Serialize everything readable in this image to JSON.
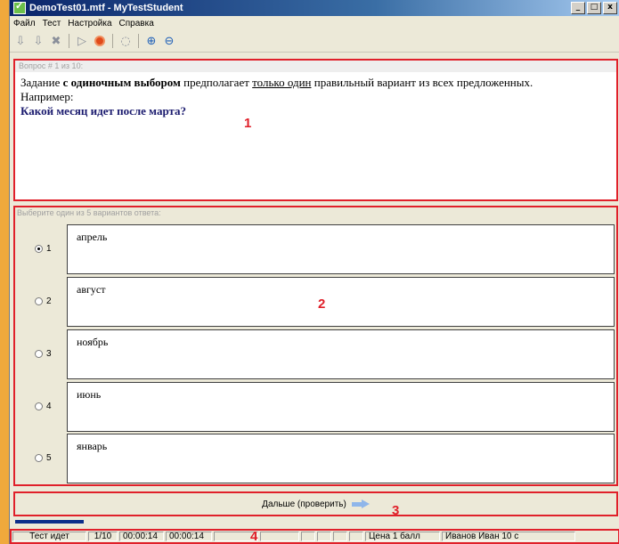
{
  "window": {
    "title": "DemoTest01.mtf - MyTestStudent"
  },
  "window_controls": {
    "minimize": "_",
    "maximize": "□",
    "close": "x"
  },
  "menu": [
    "Файл",
    "Тест",
    "Настройка",
    "Справка"
  ],
  "toolbar_icons": [
    "next-icon",
    "prev-icon",
    "delete-icon",
    "play-icon",
    "stop-icon",
    "help-icon",
    "zoom-in-icon",
    "zoom-out-icon"
  ],
  "question": {
    "header": "Вопрос # 1 из 10:",
    "text_part1": "Задание ",
    "text_bold": "с одиночным выбором",
    "text_part2": " предполагает ",
    "text_underline": "только один",
    "text_part3": " правильный вариант из всех предложенных.",
    "example_label": "Например:",
    "question_text": "Какой месяц идет после марта?"
  },
  "answers": {
    "header": "Выберите один из 5 вариантов ответа:",
    "options": [
      {
        "number": "1",
        "text": "апрель",
        "selected": true
      },
      {
        "number": "2",
        "text": "август",
        "selected": false
      },
      {
        "number": "3",
        "text": "ноябрь",
        "selected": false
      },
      {
        "number": "4",
        "text": "июнь",
        "selected": false
      },
      {
        "number": "5",
        "text": "январь",
        "selected": false
      }
    ]
  },
  "next_button": {
    "label": "Дальше (проверить)"
  },
  "progress": {
    "fraction": 0.1
  },
  "status": {
    "state": "Тест идет",
    "counter": "1/10",
    "time1": "00:00:14",
    "time2": "00:00:14",
    "price": "Цена 1 балл",
    "user": "Иванов Иван 10 с"
  },
  "annotations": [
    "1",
    "2",
    "3",
    "4"
  ],
  "colors": {
    "annotation": "#e0202a",
    "titlebar": "#0a246a",
    "question": "#1a1a6e",
    "background": "#f0a93c"
  }
}
